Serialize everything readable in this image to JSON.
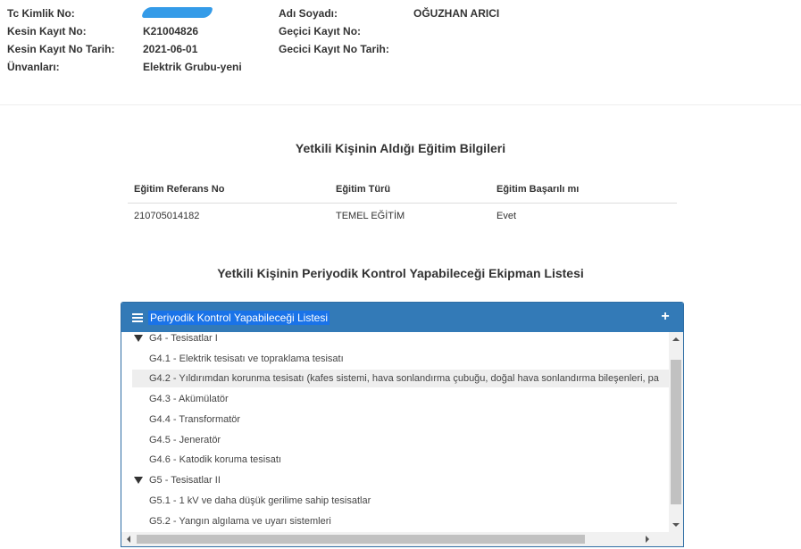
{
  "person": {
    "fields": [
      {
        "label": "Tc Kimlik No:",
        "value": ""
      },
      {
        "label": "Kesin Kayıt No:",
        "value": "K21004826"
      },
      {
        "label": "Kesin Kayıt No Tarih:",
        "value": "2021-06-01"
      },
      {
        "label": "Ünvanları:",
        "value": "Elektrik Grubu-yeni"
      },
      {
        "label": "Adı Soyadı:",
        "value": "OĞUZHAN ARICI"
      },
      {
        "label": "Geçici Kayıt No:",
        "value": ""
      },
      {
        "label": "Gecici Kayıt No Tarih:",
        "value": ""
      }
    ],
    "redacted_color": "#1e90e6"
  },
  "education": {
    "title": "Yetkili Kişinin Aldığı Eğitim Bilgileri",
    "columns": [
      "Eğitim Referans No",
      "Eğitim Türü",
      "Eğitim Başarılı mı"
    ],
    "rows": [
      [
        "210705014182",
        "TEMEL EĞİTİM",
        "Evet"
      ]
    ]
  },
  "equipment": {
    "title": "Yetkili Kişinin Periyodik Kontrol Yapabileceği Ekipman Listesi",
    "panel_title": "Periyodik Kontrol Yapabileceği Listesi",
    "add_icon": "+",
    "accent_color": "#337ab7",
    "tree": [
      {
        "type": "group",
        "label": "G4 - Tesisatlar I"
      },
      {
        "type": "child",
        "label": "G4.1 - Elektrik tesisatı ve topraklama tesisatı"
      },
      {
        "type": "child",
        "label": "G4.2 - Yıldırımdan korunma tesisatı (kafes sistemi, hava sonlandırma çubuğu, doğal hava sonlandırma bileşenleri, pa",
        "hover": true
      },
      {
        "type": "child",
        "label": "G4.3 - Akümülatör"
      },
      {
        "type": "child",
        "label": "G4.4 - Transformatör"
      },
      {
        "type": "child",
        "label": "G4.5 - Jeneratör"
      },
      {
        "type": "child",
        "label": "G4.6 - Katodik koruma tesisatı"
      },
      {
        "type": "group",
        "label": "G5 - Tesisatlar II"
      },
      {
        "type": "child",
        "label": "G5.1 - 1 kV ve daha düşük gerilime sahip tesisatlar"
      },
      {
        "type": "child",
        "label": "G5.2 - Yangın algılama ve uyarı sistemleri"
      }
    ]
  }
}
